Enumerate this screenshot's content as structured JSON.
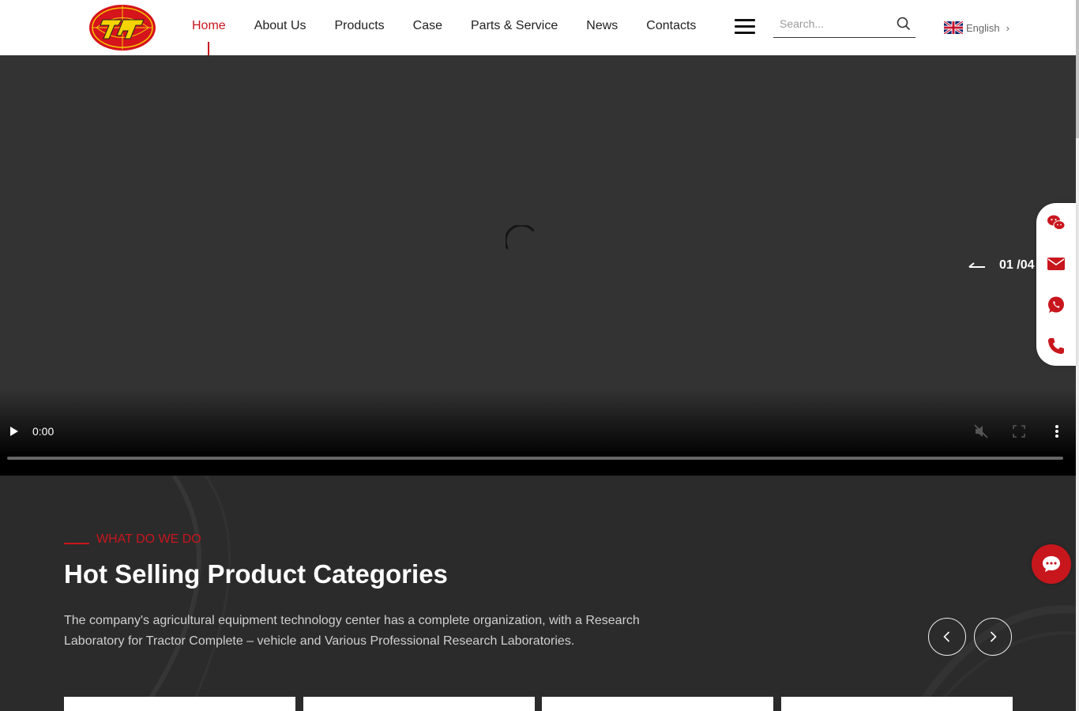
{
  "header": {
    "nav": [
      "Home",
      "About Us",
      "Products",
      "Case",
      "Parts & Service",
      "News",
      "Contacts"
    ],
    "active_nav": "Home",
    "search_placeholder": "Search...",
    "language": "English"
  },
  "video": {
    "time": "0:00",
    "progress": 0
  },
  "slider": {
    "counter": "01 /04"
  },
  "section": {
    "kicker": "WHAT DO WE DO",
    "title": "Hot Selling Product Categories",
    "description": "The company's agricultural equipment technology center has a complete organization, with a Research Laboratory for Tractor Complete – vehicle and Various Professional Research Laboratories."
  },
  "colors": {
    "brand": "#c8161d",
    "dark_bg": "#2b2b2b",
    "video_bg": "#333333"
  },
  "icons": [
    "wechat-icon",
    "mail-icon",
    "whatsapp-icon",
    "phone-icon",
    "chat-icon",
    "search-icon",
    "menu-icon",
    "uk-flag-icon"
  ]
}
